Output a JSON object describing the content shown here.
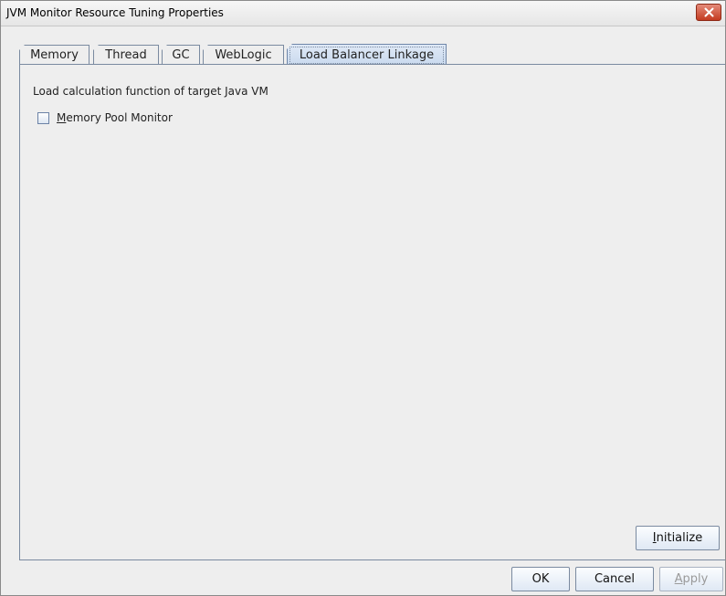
{
  "window": {
    "title": "JVM Monitor Resource Tuning Properties"
  },
  "tabs": [
    {
      "label": "Memory",
      "selected": false
    },
    {
      "label": "Thread",
      "selected": false
    },
    {
      "label": "GC",
      "selected": false
    },
    {
      "label": "WebLogic",
      "selected": false
    },
    {
      "label": "Load Balancer Linkage",
      "selected": true
    }
  ],
  "panel": {
    "section_label": "Load calculation function of target Java VM",
    "memory_pool_monitor": {
      "label": "Memory Pool Monitor",
      "checked": false
    },
    "initialize_label": "Initialize"
  },
  "footer": {
    "ok_label": "OK",
    "cancel_label": "Cancel",
    "apply_label": "Apply",
    "apply_enabled": false
  },
  "colors": {
    "accent": "#c9d9ee",
    "border": "#7a8aa0",
    "close": "#c43b21"
  },
  "icons": {
    "close": "close-icon",
    "checkbox": "checkbox-icon"
  }
}
